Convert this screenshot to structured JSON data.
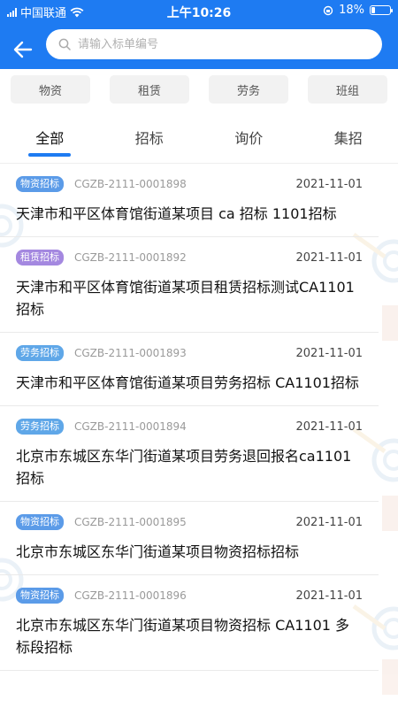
{
  "status_bar": {
    "carrier": "中国联通",
    "time": "上午10:26",
    "battery": "18%",
    "battery_level": 0.18
  },
  "search": {
    "placeholder": "请输入标单编号"
  },
  "categories": [
    "物资",
    "租赁",
    "劳务",
    "班组"
  ],
  "tabs": [
    {
      "label": "全部",
      "active": true
    },
    {
      "label": "招标",
      "active": false
    },
    {
      "label": "询价",
      "active": false
    },
    {
      "label": "集招",
      "active": false
    }
  ],
  "colors": {
    "header_blue": "#1e7bf2",
    "badge_material": "#5b9be8",
    "badge_lease": "#a488e0",
    "badge_labor": "#5fa7e8"
  },
  "items": [
    {
      "badge": "物资招标",
      "badge_type": "material",
      "code": "CGZB-2111-0001898",
      "date": "2021-11-01",
      "title": "天津市和平区体育馆街道某项目 ca 招标 1101招标"
    },
    {
      "badge": "租赁招标",
      "badge_type": "lease",
      "code": "CGZB-2111-0001892",
      "date": "2021-11-01",
      "title": "天津市和平区体育馆街道某项目租赁招标测试CA1101招标"
    },
    {
      "badge": "劳务招标",
      "badge_type": "labor",
      "code": "CGZB-2111-0001893",
      "date": "2021-11-01",
      "title": "天津市和平区体育馆街道某项目劳务招标 CA1101招标"
    },
    {
      "badge": "劳务招标",
      "badge_type": "labor",
      "code": "CGZB-2111-0001894",
      "date": "2021-11-01",
      "title": "北京市东城区东华门街道某项目劳务退回报名ca1101招标"
    },
    {
      "badge": "物资招标",
      "badge_type": "material",
      "code": "CGZB-2111-0001895",
      "date": "2021-11-01",
      "title": "北京市东城区东华门街道某项目物资招标招标"
    },
    {
      "badge": "物资招标",
      "badge_type": "material",
      "code": "CGZB-2111-0001896",
      "date": "2021-11-01",
      "title": "北京市东城区东华门街道某项目物资招标 CA1101 多标段招标"
    }
  ]
}
